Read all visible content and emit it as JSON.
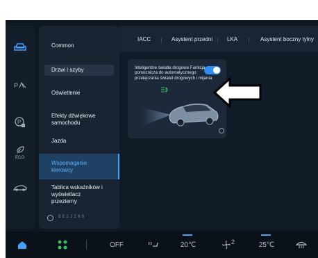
{
  "sidebar": {
    "icons": [
      "car-icon",
      "p-assist-icon",
      "parking-icon",
      "eco-icon",
      "car-body-icon"
    ]
  },
  "menu": {
    "items": [
      {
        "label": "Common"
      },
      {
        "label": "Drzwi i szyby"
      },
      {
        "label": "Oświetlenie"
      },
      {
        "label": "Efekty dźwiękowe samochodu"
      },
      {
        "label": "Jazda"
      },
      {
        "label": "Wspomaganie kierowcy"
      },
      {
        "label": "Tablica wskaźników i wyświetlacz przezierny"
      }
    ],
    "brand": "BEIJING"
  },
  "tabs": [
    "IACC",
    "Asystent przedni",
    "LKA",
    "Asystent boczny tylny"
  ],
  "card": {
    "text": "Inteligentne światła drogowe Funkcja pomocnicza do automatycznego przełączania świateł drogowych i mijania",
    "toggle_on": true
  },
  "bottom_bar": {
    "climate_status": "OFF",
    "temp_left": "20℃",
    "fan_level": "2",
    "temp_right": "25℃"
  },
  "colors": {
    "accent": "#3fa3ff",
    "toggle": "#2e8ff0"
  }
}
